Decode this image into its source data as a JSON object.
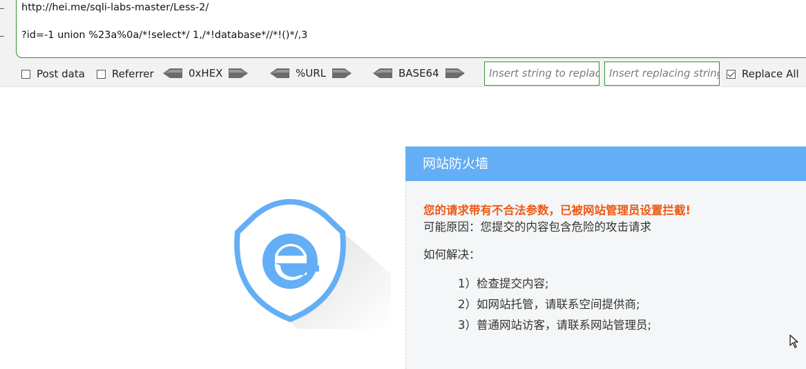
{
  "hackbar": {
    "url_line1": "http://hei.me/sqli-labs-master/Less-2/",
    "url_line2": "?id=-1 union %23a%0a/*!select*/ 1,/*!database*//*!()*/,3",
    "post_data_label": "Post data",
    "referrer_label": "Referrer",
    "hex_label": "0xHEX",
    "url_label": "%URL",
    "base64_label": "BASE64",
    "insert_placeholder": "Insert string to replace",
    "replacing_placeholder": "Insert replacing string",
    "replace_all_label": "Replace All",
    "post_data_checked": false,
    "referrer_checked": false,
    "replace_all_checked": true
  },
  "firewall": {
    "title": "网站防火墙",
    "warning": "您的请求带有不合法参数，已被网站管理员设置拦截!",
    "reason": "可能原因：您提交的内容包含危险的攻击请求",
    "how_to": "如何解决：",
    "steps": [
      "1）检查提交内容;",
      "2）如网站托管，请联系空间提供商;",
      "3）普通网站访客，请联系网站管理员;"
    ],
    "header_color": "#64aef5",
    "warning_color": "#ee5a16"
  },
  "icons": {
    "logo": "shield-e-icon",
    "arrows": "double-arrow-icon",
    "cursor": "mouse-pointer-icon"
  }
}
